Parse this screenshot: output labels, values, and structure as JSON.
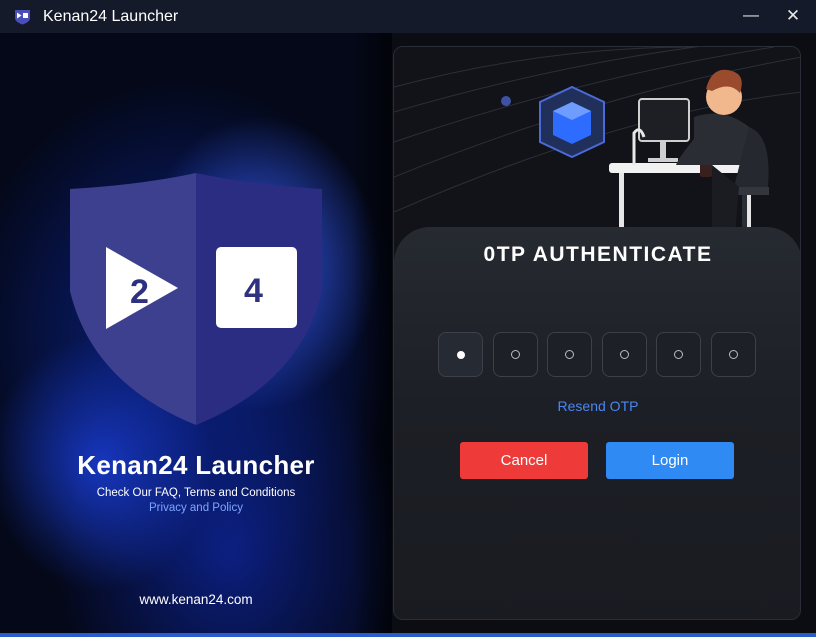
{
  "window": {
    "title": "Kenan24 Launcher",
    "minimize_glyph": "—",
    "close_glyph": "✕"
  },
  "branding": {
    "logo_left_digit": "2",
    "logo_right_digit": "4",
    "app_name": "Kenan24 Launcher",
    "faq_text": "Check Our FAQ, Terms and Conditions",
    "privacy_link": "Privacy and Policy",
    "website": "www.kenan24.com"
  },
  "otp": {
    "title": "0TP AUTHENTICATE",
    "digit_count": 6,
    "filled_count": 1,
    "resend_label": "Resend OTP",
    "cancel_label": "Cancel",
    "login_label": "Login"
  },
  "colors": {
    "cancel": "#ef3a3a",
    "login": "#2f8af4",
    "link": "#4b86f2",
    "shield_left": "#3d3f8f",
    "shield_right": "#2b2d83"
  },
  "icons": {
    "app": "play-24-icon",
    "hero": "3d-cube-and-person-at-computer-illustration"
  }
}
